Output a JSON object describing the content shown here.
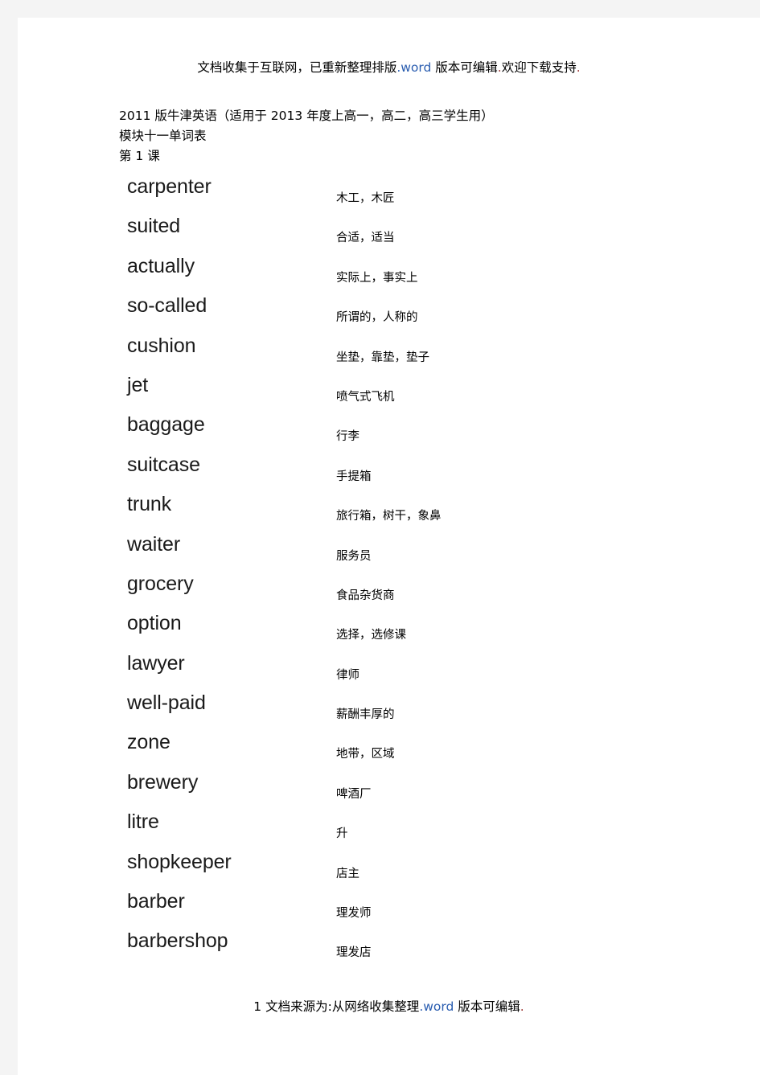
{
  "header": {
    "text_before_link": "文档收集于互联网，已重新整理排版",
    "link_text": ".word",
    "text_after_link": " 版本可编辑",
    "end_punct": ".",
    "tail": "欢迎下载支持",
    "tail_punct": "."
  },
  "footer": {
    "page_number": "1",
    "text_before_link": " 文档来源为:从网络收集整理",
    "link_text": ".word",
    "text_after_link": " 版本可编辑",
    "end_punct": "."
  },
  "title": {
    "line1": "2011 版牛津英语（适用于 2013 年度上高一，高二，高三学生用）",
    "line2": "模块十一单词表",
    "line3": "第 1 课"
  },
  "colors": {
    "page_background": "#ffffff",
    "canvas_background": "#f4f4f4",
    "body_text": "#000000",
    "term_text": "#1a1a1a",
    "link_blue": "#2a5db0",
    "punct_red": "#9e3a38"
  },
  "vocabulary": [
    {
      "term": "carpenter",
      "gloss": "木工，木匠"
    },
    {
      "term": "suited",
      "gloss": "合适，适当"
    },
    {
      "term": "actually",
      "gloss": "实际上，事实上"
    },
    {
      "term": "so-called",
      "gloss": "所谓的，人称的"
    },
    {
      "term": "cushion",
      "gloss": "坐垫，靠垫，垫子"
    },
    {
      "term": "jet",
      "gloss": "喷气式飞机"
    },
    {
      "term": "baggage",
      "gloss": "行李"
    },
    {
      "term": "suitcase",
      "gloss": "手提箱"
    },
    {
      "term": "trunk",
      "gloss": "旅行箱，树干，象鼻"
    },
    {
      "term": "waiter",
      "gloss": "服务员"
    },
    {
      "term": "grocery",
      "gloss": "食品杂货商"
    },
    {
      "term": "option",
      "gloss": "选择，选修课"
    },
    {
      "term": "lawyer",
      "gloss": "律师"
    },
    {
      "term": "well-paid",
      "gloss": "薪酬丰厚的"
    },
    {
      "term": "zone",
      "gloss": "地带，区域"
    },
    {
      "term": "brewery",
      "gloss": "啤酒厂"
    },
    {
      "term": "litre",
      "gloss": "升"
    },
    {
      "term": "shopkeeper",
      "gloss": "店主"
    },
    {
      "term": "barber",
      "gloss": "理发师"
    },
    {
      "term": "barbershop",
      "gloss": "理发店"
    }
  ]
}
